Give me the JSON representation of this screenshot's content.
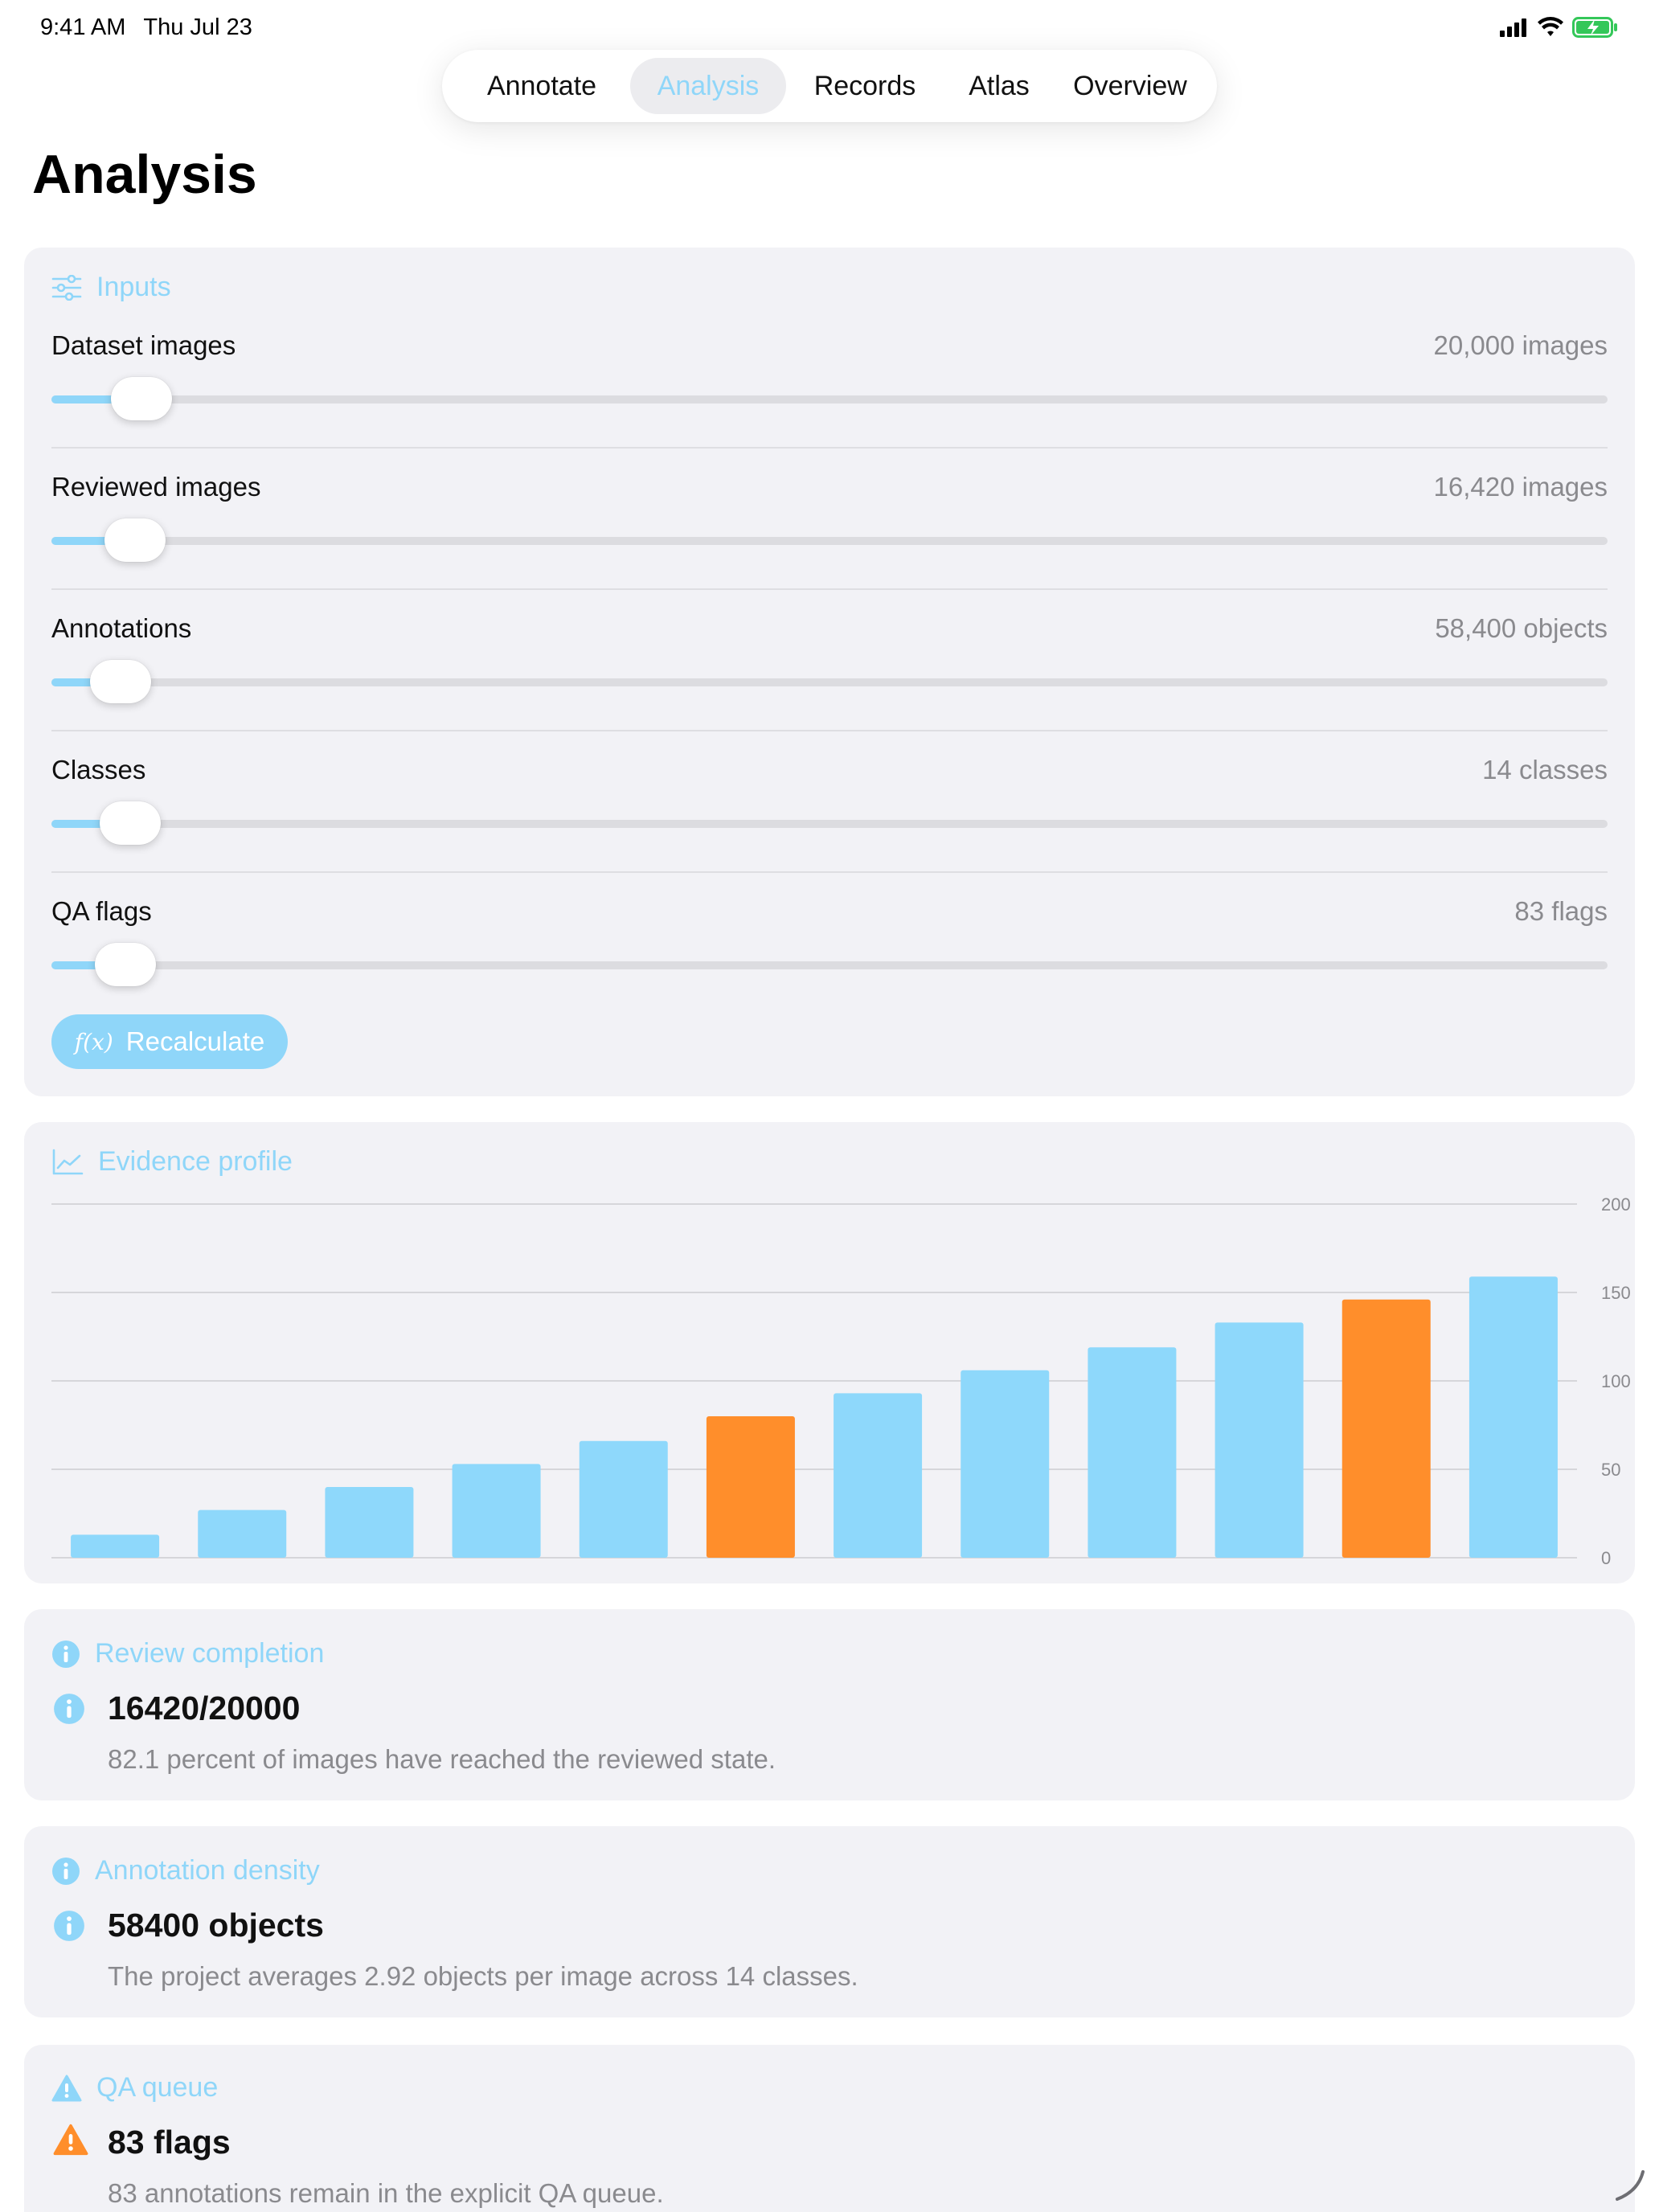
{
  "status_bar": {
    "time": "9:41 AM",
    "date": "Thu Jul 23"
  },
  "nav": {
    "tabs": [
      {
        "label": "Annotate"
      },
      {
        "label": "Analysis"
      },
      {
        "label": "Records"
      },
      {
        "label": "Atlas"
      },
      {
        "label": "Overview"
      }
    ],
    "active": "Analysis"
  },
  "page_title": "Analysis",
  "inputs": {
    "header": "Inputs",
    "sliders": [
      {
        "label": "Dataset images",
        "value": "20,000 images",
        "fraction": 0.038
      },
      {
        "label": "Reviewed images",
        "value": "16,420 images",
        "fraction": 0.034
      },
      {
        "label": "Annotations",
        "value": "58,400 objects",
        "fraction": 0.025
      },
      {
        "label": "Classes",
        "value": "14 classes",
        "fraction": 0.031
      },
      {
        "label": "QA flags",
        "value": "83 flags",
        "fraction": 0.028
      }
    ],
    "recalculate_label": "Recalculate",
    "recalculate_icon": "f(x)"
  },
  "evidence": {
    "header": "Evidence profile"
  },
  "chart_data": {
    "type": "bar",
    "values": [
      13,
      27,
      40,
      53,
      66,
      80,
      93,
      106,
      119,
      133,
      146,
      159
    ],
    "highlight_indices": [
      5,
      10
    ],
    "yticks": [
      "0",
      "50",
      "100",
      "150",
      "200"
    ],
    "ylim": [
      0,
      200
    ],
    "grid": true,
    "colors": {
      "bar": "#8ed8fb",
      "highlight": "#ff8e2b"
    }
  },
  "review": {
    "header": "Review completion",
    "title": "16420/20000",
    "desc": "82.1 percent of images have reached the reviewed state."
  },
  "density": {
    "header": "Annotation density",
    "title": "58400 objects",
    "desc": "The project averages 2.92 objects per image across 14 classes."
  },
  "qa": {
    "header": "QA queue",
    "title": "83 flags",
    "desc": "83 annotations remain in the explicit QA queue."
  },
  "colors": {
    "accent": "#8fd6f9",
    "warning": "#ff8e2b",
    "card": "#f2f2f6"
  }
}
